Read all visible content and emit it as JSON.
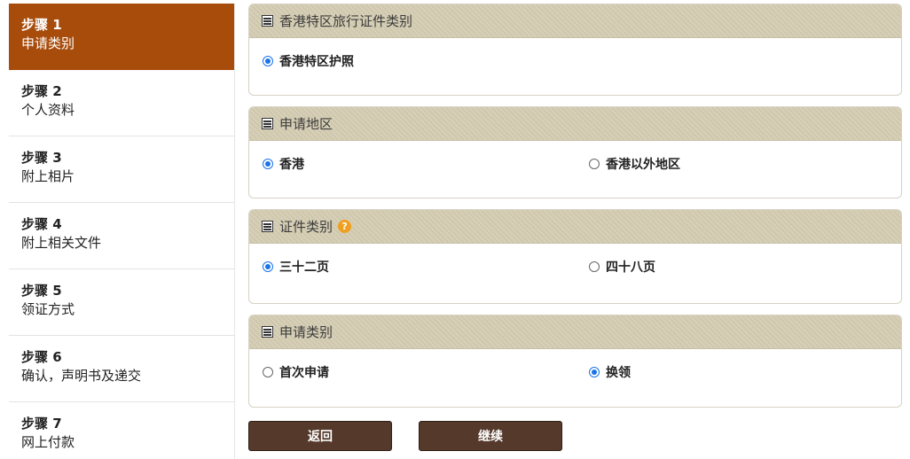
{
  "sidebar": {
    "steps": [
      {
        "num": "步骤 1",
        "label": "申请类别",
        "active": true
      },
      {
        "num": "步骤 2",
        "label": "个人资料"
      },
      {
        "num": "步骤 3",
        "label": "附上相片"
      },
      {
        "num": "步骤 4",
        "label": "附上相关文件"
      },
      {
        "num": "步骤 5",
        "label": "领证方式"
      },
      {
        "num": "步骤 6",
        "label": "确认，声明书及递交"
      },
      {
        "num": "步骤 7",
        "label": "网上付款"
      }
    ]
  },
  "panels": {
    "doc_type": {
      "title": "香港特区旅行证件类别",
      "options": [
        {
          "label": "香港特区护照",
          "checked": true
        }
      ]
    },
    "region": {
      "title": "申请地区",
      "options": [
        {
          "label": "香港",
          "checked": true
        },
        {
          "label": "香港以外地区",
          "checked": false
        }
      ]
    },
    "cert_type": {
      "title": "证件类别",
      "help_icon": "question-circle-icon",
      "options": [
        {
          "label": "三十二页",
          "checked": true
        },
        {
          "label": "四十八页",
          "checked": false
        }
      ]
    },
    "app_type": {
      "title": "申请类别",
      "options": [
        {
          "label": "首次申请",
          "checked": false
        },
        {
          "label": "换领",
          "checked": true
        }
      ]
    }
  },
  "buttons": {
    "back": "返回",
    "continue": "继续"
  },
  "colors": {
    "active_step": "#a84c0c",
    "button": "#553a2c",
    "radio_checked": "#1a73e8",
    "help_icon": "#f0a020"
  }
}
